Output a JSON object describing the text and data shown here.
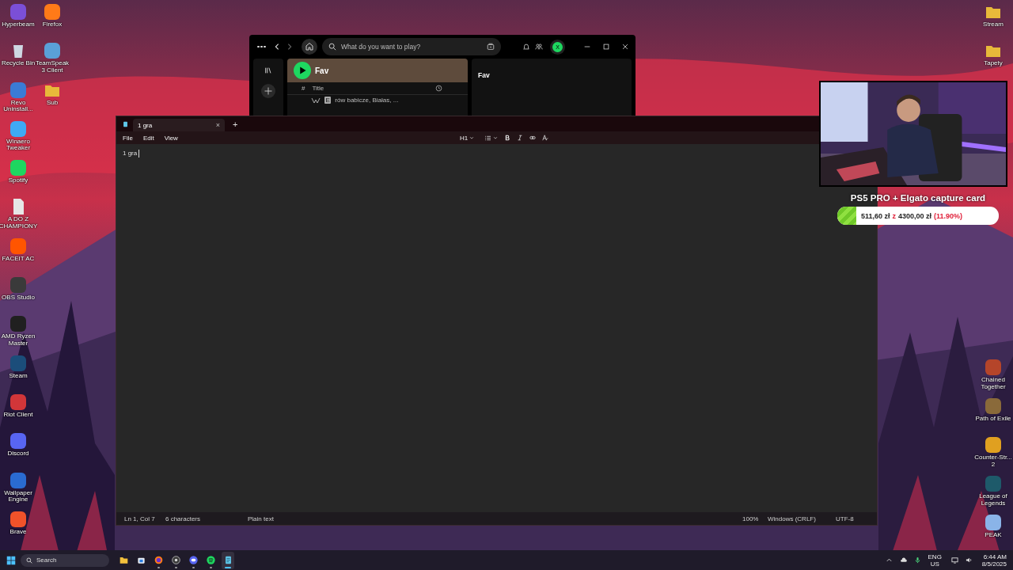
{
  "left_icons": [
    {
      "label": "Hyperbeam",
      "kind": "app",
      "color": "#7b4fd6"
    },
    {
      "label": "Recycle Bin",
      "kind": "bin",
      "color": "#cfd8e3"
    },
    {
      "label": "Revo Uninstall...",
      "kind": "app",
      "color": "#3a7bd5"
    },
    {
      "label": "Winaero Tweaker",
      "kind": "app",
      "color": "#3fa9f5"
    },
    {
      "label": "Spotify",
      "kind": "app",
      "color": "#1ed760"
    },
    {
      "label": "A DO Z CHAMPIONY",
      "kind": "file",
      "color": "#e6e6e6"
    },
    {
      "label": "FACEIT AC",
      "kind": "app",
      "color": "#ff5500"
    },
    {
      "label": "OBS Studio",
      "kind": "app",
      "color": "#3a3a3a"
    },
    {
      "label": "AMD Ryzen Master",
      "kind": "app",
      "color": "#202020"
    },
    {
      "label": "Steam",
      "kind": "app",
      "color": "#1b4d7a"
    },
    {
      "label": "Riot Client",
      "kind": "app",
      "color": "#d13639"
    },
    {
      "label": "Discord",
      "kind": "app",
      "color": "#5865f2"
    },
    {
      "label": "Wallpaper Engine",
      "kind": "app",
      "color": "#2a6bd1"
    },
    {
      "label": "Brave",
      "kind": "app",
      "color": "#f0522a"
    },
    {
      "label": "Firefox",
      "kind": "app",
      "color": "#ff7a18"
    },
    {
      "label": "TeamSpeak 3 Client",
      "kind": "app",
      "color": "#5aa0d8"
    },
    {
      "label": "Sub",
      "kind": "folder",
      "color": "#e8b93a"
    }
  ],
  "right_top_icons": [
    {
      "label": "Stream",
      "kind": "folder",
      "color": "#e8b93a"
    },
    {
      "label": "Tapety",
      "kind": "folder",
      "color": "#e8b93a"
    }
  ],
  "right_bottom_icons": [
    {
      "label": "Chained Together",
      "kind": "app",
      "color": "#b5452a"
    },
    {
      "label": "Path of Exile",
      "kind": "app",
      "color": "#8a6a3a"
    },
    {
      "label": "Counter-Str... 2",
      "kind": "app",
      "color": "#e0a020"
    },
    {
      "label": "League of Legends",
      "kind": "app",
      "color": "#1e5a6a"
    },
    {
      "label": "PEAK",
      "kind": "app",
      "color": "#8ab4e8"
    }
  ],
  "spotify": {
    "search": {
      "placeholder": "What do you want to play?"
    },
    "avatar": "X",
    "playlist_title": "Fav",
    "columns": [
      "#",
      "Title"
    ],
    "track": {
      "explicit": "E",
      "artists": "rów babicze, Białas, ..."
    },
    "side_panel_title": "Fav"
  },
  "notepad": {
    "tab": {
      "title": "1 gra",
      "close": "×"
    },
    "new_tab": "+",
    "menu": [
      "File",
      "Edit",
      "View"
    ],
    "heading": "H1",
    "text": "1 gra",
    "status": {
      "position": "Ln 1, Col 7",
      "characters": "6 characters",
      "format": "Plain text",
      "zoom": "100%",
      "line_ending": "Windows (CRLF)",
      "encoding": "UTF-8"
    }
  },
  "stream_overlay": {
    "goal_title": "PS5 PRO + Elgato capture card",
    "raised": "511,60 zł",
    "separator": "z",
    "goal": "4300,00 zł",
    "percent": "(11.90%)",
    "level": 0.119
  },
  "taskbar": {
    "search": {
      "placeholder": "Search"
    },
    "apps": [
      {
        "kind": "files",
        "running": false,
        "selected": false
      },
      {
        "kind": "store",
        "running": false,
        "selected": false
      },
      {
        "kind": "firefox",
        "running": true,
        "selected": false
      },
      {
        "kind": "obs",
        "running": true,
        "selected": false
      },
      {
        "kind": "discord",
        "running": true,
        "selected": false
      },
      {
        "kind": "spotify",
        "running": true,
        "selected": false
      },
      {
        "kind": "notepad",
        "running": true,
        "selected": true
      }
    ],
    "language": "ENG",
    "region": "US",
    "time": "6:44 AM",
    "date": "8/5/2025"
  }
}
